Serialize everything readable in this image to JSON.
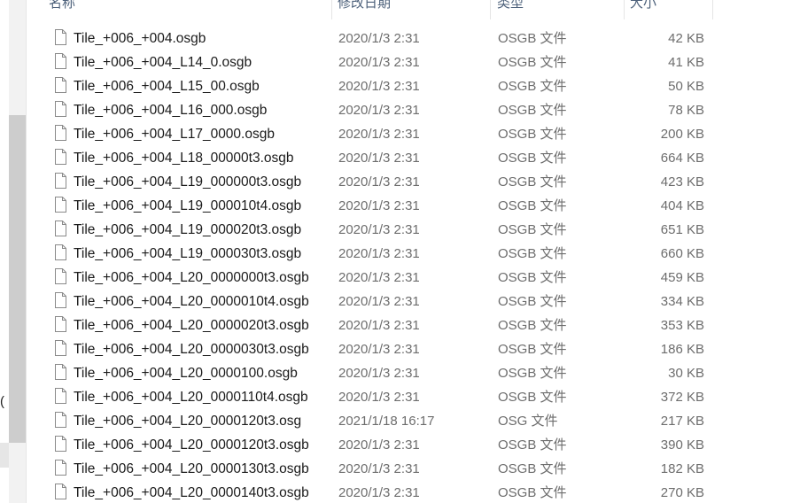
{
  "headers": {
    "name": "名称",
    "date": "修改日期",
    "type": "类型",
    "size": "大小"
  },
  "nav": {
    "fragment": "( ("
  },
  "files": [
    {
      "name": "Tile_+006_+004.osgb",
      "date": "2020/1/3 2:31",
      "type": "OSGB 文件",
      "size": "42 KB"
    },
    {
      "name": "Tile_+006_+004_L14_0.osgb",
      "date": "2020/1/3 2:31",
      "type": "OSGB 文件",
      "size": "41 KB"
    },
    {
      "name": "Tile_+006_+004_L15_00.osgb",
      "date": "2020/1/3 2:31",
      "type": "OSGB 文件",
      "size": "50 KB"
    },
    {
      "name": "Tile_+006_+004_L16_000.osgb",
      "date": "2020/1/3 2:31",
      "type": "OSGB 文件",
      "size": "78 KB"
    },
    {
      "name": "Tile_+006_+004_L17_0000.osgb",
      "date": "2020/1/3 2:31",
      "type": "OSGB 文件",
      "size": "200 KB"
    },
    {
      "name": "Tile_+006_+004_L18_00000t3.osgb",
      "date": "2020/1/3 2:31",
      "type": "OSGB 文件",
      "size": "664 KB"
    },
    {
      "name": "Tile_+006_+004_L19_000000t3.osgb",
      "date": "2020/1/3 2:31",
      "type": "OSGB 文件",
      "size": "423 KB"
    },
    {
      "name": "Tile_+006_+004_L19_000010t4.osgb",
      "date": "2020/1/3 2:31",
      "type": "OSGB 文件",
      "size": "404 KB"
    },
    {
      "name": "Tile_+006_+004_L19_000020t3.osgb",
      "date": "2020/1/3 2:31",
      "type": "OSGB 文件",
      "size": "651 KB"
    },
    {
      "name": "Tile_+006_+004_L19_000030t3.osgb",
      "date": "2020/1/3 2:31",
      "type": "OSGB 文件",
      "size": "660 KB"
    },
    {
      "name": "Tile_+006_+004_L20_0000000t3.osgb",
      "date": "2020/1/3 2:31",
      "type": "OSGB 文件",
      "size": "459 KB"
    },
    {
      "name": "Tile_+006_+004_L20_0000010t4.osgb",
      "date": "2020/1/3 2:31",
      "type": "OSGB 文件",
      "size": "334 KB"
    },
    {
      "name": "Tile_+006_+004_L20_0000020t3.osgb",
      "date": "2020/1/3 2:31",
      "type": "OSGB 文件",
      "size": "353 KB"
    },
    {
      "name": "Tile_+006_+004_L20_0000030t3.osgb",
      "date": "2020/1/3 2:31",
      "type": "OSGB 文件",
      "size": "186 KB"
    },
    {
      "name": "Tile_+006_+004_L20_0000100.osgb",
      "date": "2020/1/3 2:31",
      "type": "OSGB 文件",
      "size": "30 KB"
    },
    {
      "name": "Tile_+006_+004_L20_0000110t4.osgb",
      "date": "2020/1/3 2:31",
      "type": "OSGB 文件",
      "size": "372 KB"
    },
    {
      "name": "Tile_+006_+004_L20_0000120t3.osg",
      "date": "2021/1/18 16:17",
      "type": "OSG 文件",
      "size": "217 KB"
    },
    {
      "name": "Tile_+006_+004_L20_0000120t3.osgb",
      "date": "2020/1/3 2:31",
      "type": "OSGB 文件",
      "size": "390 KB"
    },
    {
      "name": "Tile_+006_+004_L20_0000130t3.osgb",
      "date": "2020/1/3 2:31",
      "type": "OSGB 文件",
      "size": "182 KB"
    },
    {
      "name": "Tile_+006_+004_L20_0000140t3.osgb",
      "date": "2020/1/3 2:31",
      "type": "OSGB 文件",
      "size": "270 KB"
    }
  ]
}
